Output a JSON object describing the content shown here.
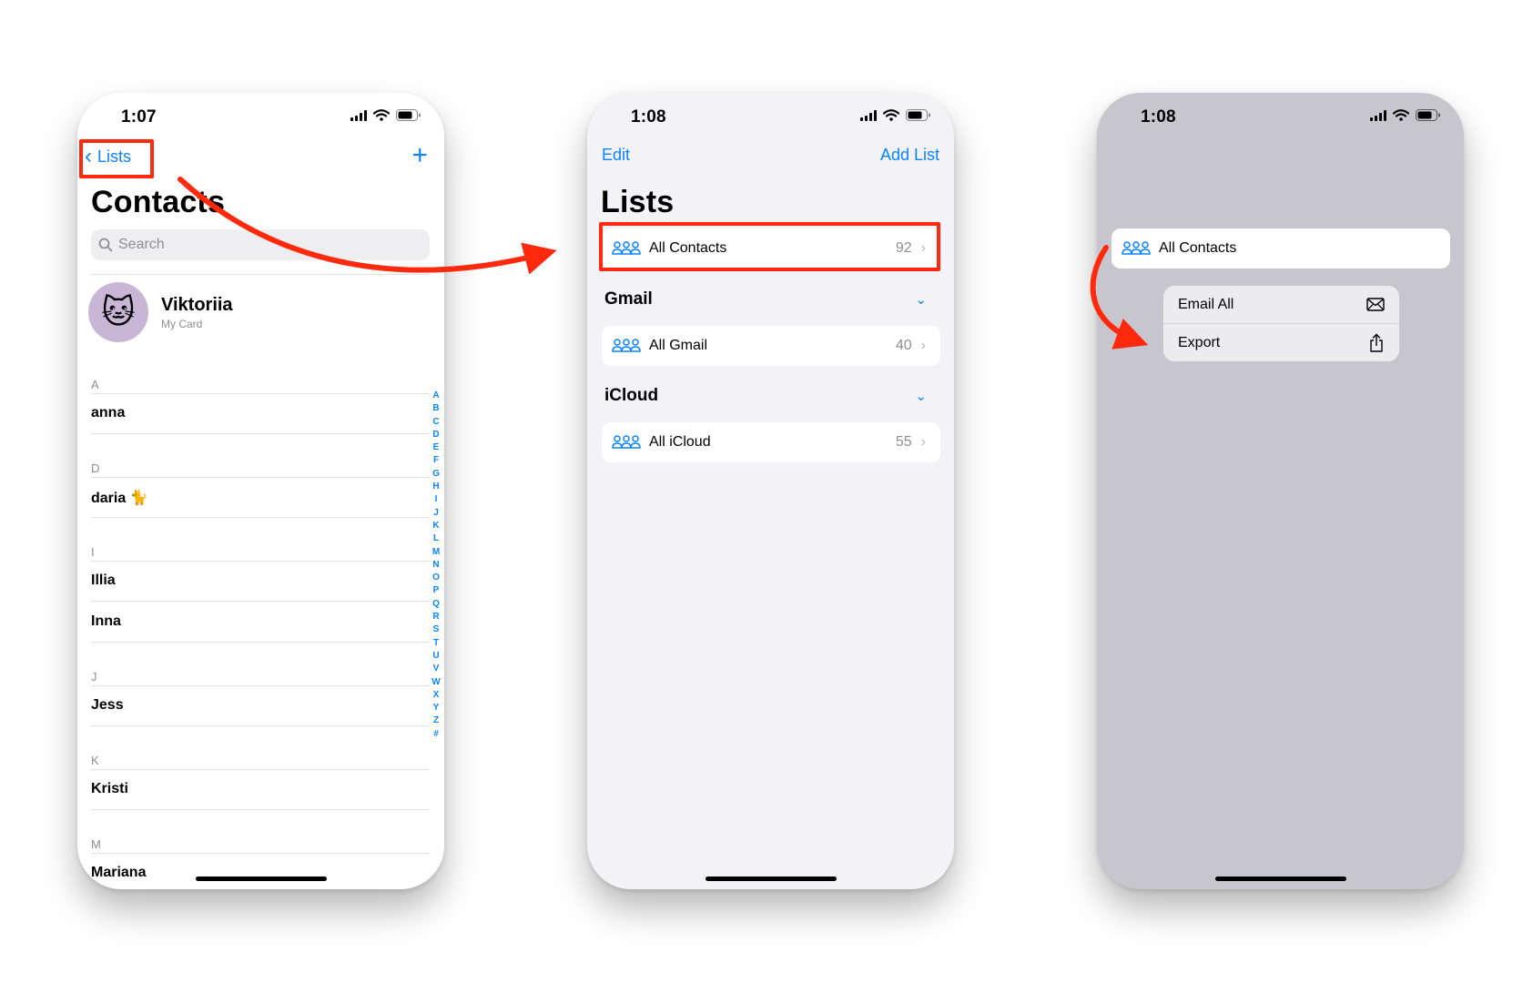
{
  "colors": {
    "accent": "#0a84ff",
    "annotation": "#ff2a0d",
    "secondary_text": "#8e8e93"
  },
  "screen1": {
    "status_time": "1:07",
    "nav_back_label": "Lists",
    "nav_add_icon": "plus-icon",
    "title": "Contacts",
    "search_placeholder": "Search",
    "my_card": {
      "avatar_emoji": "🐱",
      "name": "Viktoriia",
      "subtitle": "My Card"
    },
    "sections": [
      {
        "letter": "A",
        "names": [
          "anna"
        ]
      },
      {
        "letter": "D",
        "names": [
          "daria 🐈"
        ]
      },
      {
        "letter": "I",
        "names": [
          "Illia",
          "Inna"
        ]
      },
      {
        "letter": "J",
        "names": [
          "Jess"
        ]
      },
      {
        "letter": "K",
        "names": [
          "Kristi"
        ]
      },
      {
        "letter": "M",
        "names": [
          "Mariana"
        ]
      }
    ],
    "index_letters": [
      "A",
      "B",
      "C",
      "D",
      "E",
      "F",
      "G",
      "H",
      "I",
      "J",
      "K",
      "L",
      "M",
      "N",
      "O",
      "P",
      "Q",
      "R",
      "S",
      "T",
      "U",
      "V",
      "W",
      "X",
      "Y",
      "Z",
      "#"
    ]
  },
  "screen2": {
    "status_time": "1:08",
    "nav_left": "Edit",
    "nav_right": "Add List",
    "title": "Lists",
    "all_contacts": {
      "label": "All Contacts",
      "count": "92"
    },
    "groups": [
      {
        "name": "Gmail",
        "row": {
          "label": "All Gmail",
          "count": "40"
        }
      },
      {
        "name": "iCloud",
        "row": {
          "label": "All iCloud",
          "count": "55"
        }
      }
    ]
  },
  "screen3": {
    "status_time": "1:08",
    "preview_label": "All Contacts",
    "menu": [
      {
        "label": "Email All",
        "icon": "envelope-icon"
      },
      {
        "label": "Export",
        "icon": "share-icon"
      }
    ]
  }
}
